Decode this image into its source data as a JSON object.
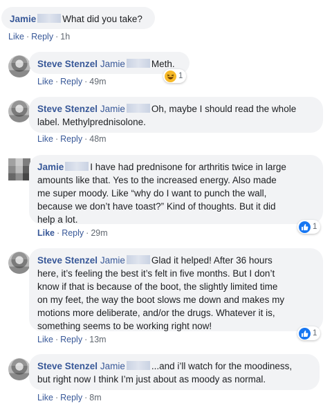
{
  "comments": [
    {
      "author": "Jamie",
      "text": "What did you take?",
      "actions": {
        "like": "Like",
        "reply": "Reply",
        "time": "1h"
      }
    },
    {
      "author": "Steve Stenzel",
      "mention": "Jamie",
      "text": "Meth.",
      "actions": {
        "like": "Like",
        "reply": "Reply",
        "time": "49m"
      },
      "reaction": {
        "icon": "haha-icon",
        "count": "1"
      }
    },
    {
      "author": "Steve Stenzel",
      "mention": "Jamie",
      "text_line1": "Oh, maybe I should read the whole",
      "text_line2": "label. Methylprednisolone.",
      "actions": {
        "like": "Like",
        "reply": "Reply",
        "time": "48m"
      }
    },
    {
      "author": "Jamie",
      "text_line1": "I have had prednisone for arthritis twice in large",
      "text_line2": "amounts like that. Yes to the increased energy. Also made",
      "text_line3": "me super moody. Like “why do I want to punch the wall,",
      "text_line4": "because we don’t have toast?” Kind of thoughts. But it did",
      "text_line5": "help a lot.",
      "actions": {
        "like": "Like",
        "reply": "Reply",
        "time": "29m"
      },
      "reaction": {
        "icon": "like-icon",
        "count": "1"
      }
    },
    {
      "author": "Steve Stenzel",
      "mention": "Jamie",
      "text_line1": "Glad it helped! After 36 hours",
      "text_line2": "here, it’s feeling the best it’s felt in five months. But I don’t",
      "text_line3": "know if that is because of the boot, the slightly limited time",
      "text_line4": "on my feet, the way the boot slows me down and makes my",
      "text_line5": "motions more deliberate, and/or the drugs. Whatever it is,",
      "text_line6": "something seems to be working right now!",
      "actions": {
        "like": "Like",
        "reply": "Reply",
        "time": "13m"
      },
      "reaction": {
        "icon": "like-icon",
        "count": "1"
      }
    },
    {
      "author": "Steve Stenzel",
      "mention": "Jamie",
      "text_line1": "...and i’ll watch for the moodiness,",
      "text_line2": "but right now I think I’m just about as moody as normal.",
      "actions": {
        "like": "Like",
        "reply": "Reply",
        "time": "8m"
      }
    }
  ],
  "colors": {
    "link": "#385898",
    "bubble": "#f2f3f5",
    "meta": "#606770",
    "like_blue": "#1877f2",
    "haha_yellow": "#f7b928"
  }
}
